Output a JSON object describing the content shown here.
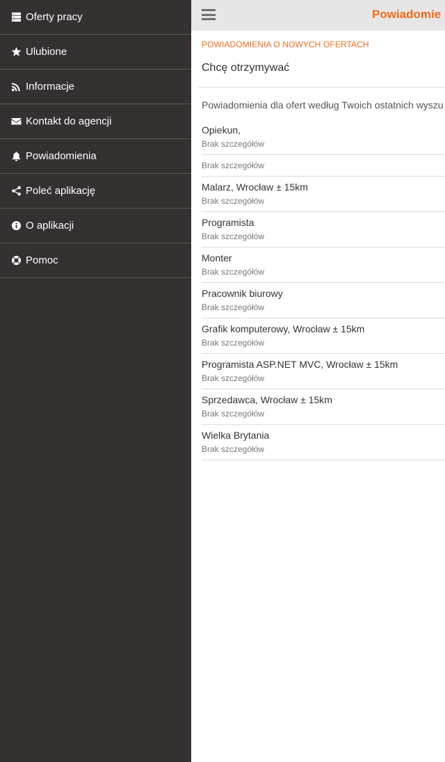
{
  "sidebar": {
    "items": [
      {
        "label": "Oferty pracy",
        "icon": "server-list-icon"
      },
      {
        "label": "Ulubione",
        "icon": "star-icon"
      },
      {
        "label": "Informacje",
        "icon": "rss-icon"
      },
      {
        "label": "Kontakt do agencji",
        "icon": "envelope-icon"
      },
      {
        "label": "Powiadomienia",
        "icon": "bell-icon"
      },
      {
        "label": "Poleć aplikację",
        "icon": "share-icon"
      },
      {
        "label": "O aplikacji",
        "icon": "info-icon"
      },
      {
        "label": "Pomoc",
        "icon": "lifebuoy-icon"
      }
    ]
  },
  "header": {
    "title": "Powiadomie"
  },
  "main": {
    "section_header": "POWIADOMIENIA O NOWYCH OFERTACH",
    "receive_label": "Chcę otrzymywać",
    "description": "Powiadomienia dla ofert według Twoich ostatnich wyszu",
    "notifications": [
      {
        "title": "Opiekun,",
        "subtitle": "Brak szczegółów"
      },
      {
        "title": "",
        "subtitle": "Brak szczegółów"
      },
      {
        "title": "Malarz, Wrocław ± 15km",
        "subtitle": "Brak szczegółów"
      },
      {
        "title": "Programista",
        "subtitle": "Brak szczegółów"
      },
      {
        "title": "Monter",
        "subtitle": "Brak szczegółów"
      },
      {
        "title": "Pracownik biurowy",
        "subtitle": "Brak szczegółów"
      },
      {
        "title": "Grafik komputerowy, Wrocław ± 15km",
        "subtitle": "Brak szczegółów"
      },
      {
        "title": "Programista ASP.NET MVC, Wrocław ± 15km",
        "subtitle": "Brak szczegółów"
      },
      {
        "title": "Sprzedawca, Wrocław ± 15km",
        "subtitle": "Brak szczegółów"
      },
      {
        "title": "Wielka Brytania",
        "subtitle": "Brak szczegółów"
      }
    ]
  },
  "colors": {
    "accent": "#f26b1d",
    "sidebar_bg": "#353130",
    "topbar_bg": "#e6e6e6"
  }
}
